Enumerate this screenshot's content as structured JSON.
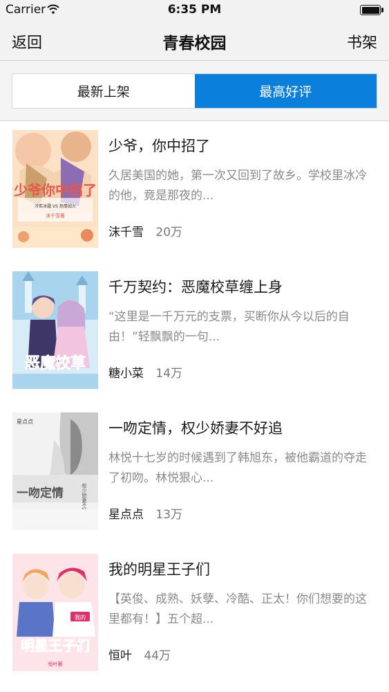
{
  "status_bar": {
    "carrier": "Carrier",
    "time": "6:35 PM"
  },
  "nav": {
    "back_label": "返回",
    "title": "青春校园",
    "right_label": "书架"
  },
  "segments": [
    {
      "label": "最新上架",
      "active": false
    },
    {
      "label": "最高好评",
      "active": true
    }
  ],
  "books": [
    {
      "title": "少爷，你中招了",
      "description": "久居美国的她，第一次又回到了故乡。学校里冰冷的他，竟是那夜的...",
      "author": "沫千雪",
      "count": "20万",
      "cover": {
        "title_text": "少爷你中招了",
        "top_line": "冷若冰霜 VS 热情如火",
        "author_text": "沫千雪著",
        "colors": [
          "#f6c7a6",
          "#e8574a",
          "#fde7c8"
        ]
      }
    },
    {
      "title": "千万契约：恶魔校草缠上身",
      "description": "“这里是一千万元的支票，买断你从今以后的自由！”轻飘飘的一句...",
      "author": "糖小菜",
      "count": "14万",
      "cover": {
        "title_text": "恶魔校草",
        "colors": [
          "#a8d4ee",
          "#5d4c8e",
          "#c9a8d8"
        ]
      }
    },
    {
      "title": "一吻定情，权少娇妻不好追",
      "description": "林悦十七岁的时候遇到了韩旭东，被他霸道的夺走了初吻。林悦狠心...",
      "author": "星点点",
      "count": "13万",
      "cover": {
        "title_text": "一吻定情",
        "sub_text": "权少娇妻不好追",
        "publisher": "星点点",
        "colors": [
          "#eeeeee",
          "#555555",
          "#c8c8c8"
        ]
      }
    },
    {
      "title": "我的明星王子们",
      "description": "【英俊、成熟、妖孽、冷酷、正太！你们想要的这里都有！】五个超...",
      "author": "恒叶",
      "count": "44万",
      "cover": {
        "title_text": "明星王子们",
        "tag": "我的",
        "author_text": "恒叶著",
        "colors": [
          "#fde4e8",
          "#e0306a",
          "#f7a35a"
        ]
      }
    }
  ]
}
